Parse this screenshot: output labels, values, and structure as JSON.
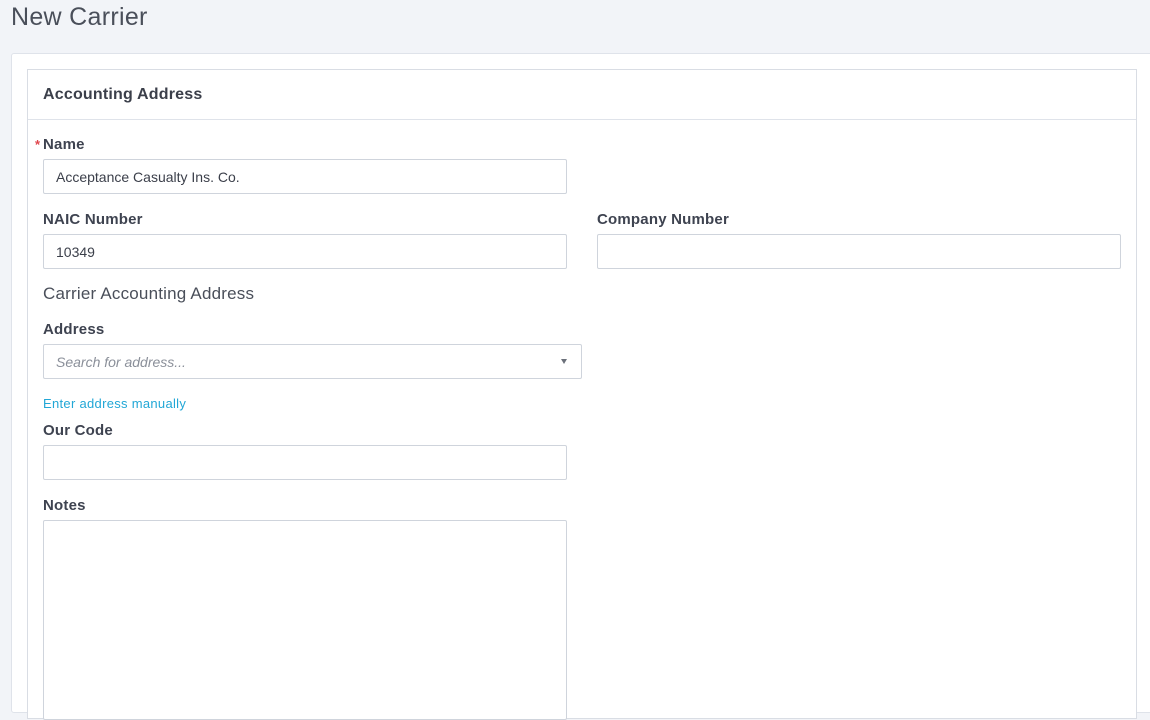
{
  "page": {
    "title": "New Carrier"
  },
  "card": {
    "title": "Accounting Address"
  },
  "fields": {
    "name": {
      "label": "Name",
      "required_marker": "*",
      "value": "Acceptance Casualty Ins. Co."
    },
    "naic_number": {
      "label": "NAIC Number",
      "value": "10349"
    },
    "company_number": {
      "label": "Company Number",
      "value": ""
    },
    "address": {
      "label": "Address",
      "placeholder": "Search for address..."
    },
    "manual_address_link": "Enter address manually",
    "our_code": {
      "label": "Our Code",
      "value": ""
    },
    "notes": {
      "label": "Notes",
      "value": ""
    }
  },
  "sections": {
    "carrier_accounting_address": "Carrier Accounting Address"
  },
  "icons": {
    "address_dropdown": "caret-down-icon"
  },
  "colors": {
    "required": "#e0454b",
    "link": "#22a7d6",
    "page_background": "#f2f4f8"
  }
}
